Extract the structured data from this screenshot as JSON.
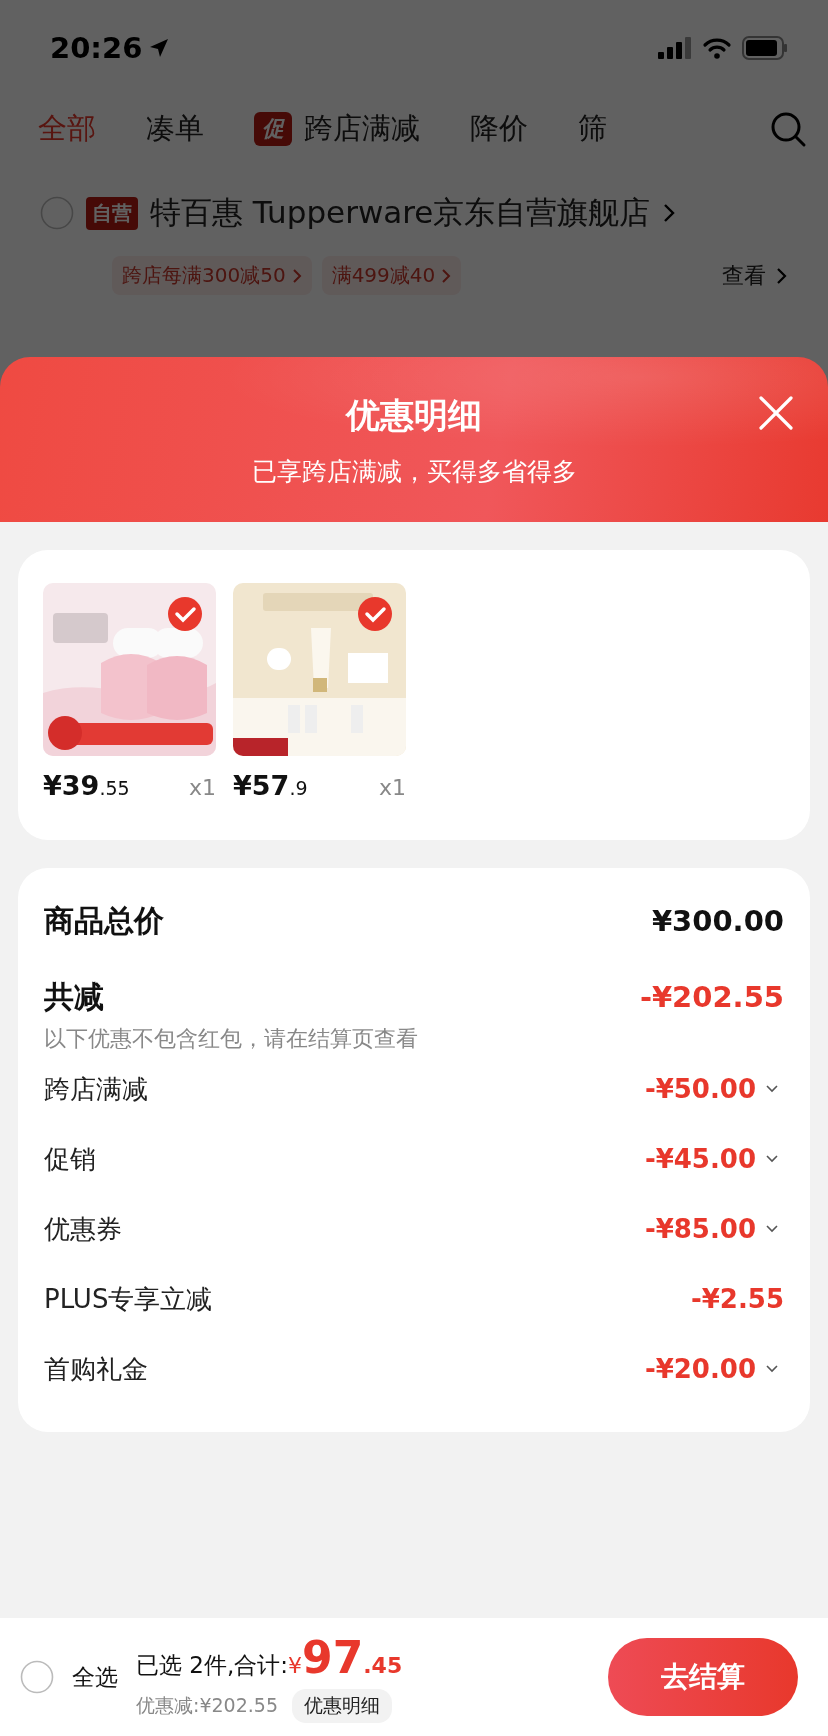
{
  "status_bar": {
    "time": "20:26"
  },
  "tabs": [
    {
      "label": "全部",
      "selected": true
    },
    {
      "label": "凑单",
      "selected": false
    },
    {
      "label": "跨店满减",
      "selected": false,
      "badge": "促"
    },
    {
      "label": "降价",
      "selected": false
    },
    {
      "label": "筛",
      "selected": false
    }
  ],
  "store": {
    "checked": false,
    "tag": "自营",
    "name": "特百惠 Tupperware京东自营旗舰店",
    "promos": [
      "跨店每满300减50",
      "满499减40"
    ],
    "view_link": "查看"
  },
  "sheet": {
    "title": "优惠明细",
    "subtitle": "已享跨店满减，买得多省得多"
  },
  "products": [
    {
      "selected": true,
      "price_main": "¥39",
      "price_fraction": ".55",
      "quantity": "x1"
    },
    {
      "selected": true,
      "price_main": "¥57",
      "price_fraction": ".9",
      "quantity": "x1"
    }
  ],
  "summary": {
    "total_label": "商品总价",
    "total_value": "¥300.00",
    "discount_label": "共减",
    "discount_value": "-¥202.55",
    "note": "以下优惠不包含红包，请在结算页查看"
  },
  "discounts": [
    {
      "label": "跨店满减",
      "value": "-¥50.00",
      "expandable": true
    },
    {
      "label": "促销",
      "value": "-¥45.00",
      "expandable": true
    },
    {
      "label": "优惠券",
      "value": "-¥85.00",
      "expandable": true
    },
    {
      "label": "PLUS专享立减",
      "value": "-¥2.55",
      "expandable": false
    },
    {
      "label": "首购礼金",
      "value": "-¥20.00",
      "expandable": true
    }
  ],
  "bottom_bar": {
    "select_all_checked": false,
    "select_all_label": "全选",
    "selected_label": "已选 2件,合计:",
    "total_currency": "¥",
    "total_main": "97",
    "total_fraction": ".45",
    "saved": "优惠减:¥202.55",
    "details_button": "优惠明细",
    "checkout_button": "去结算"
  }
}
